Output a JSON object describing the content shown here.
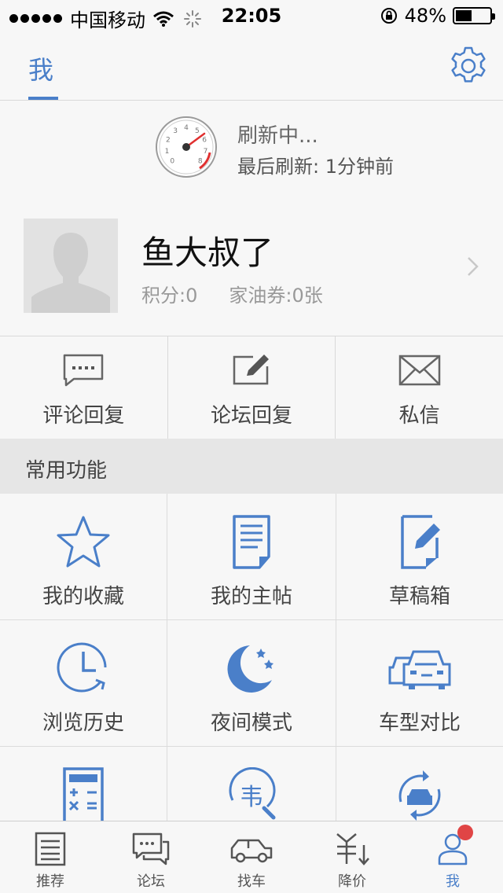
{
  "status_bar": {
    "carrier": "中国移动",
    "time": "22:05",
    "battery_percent": "48%",
    "battery_level": 0.48
  },
  "nav": {
    "tab_label": "我",
    "accent_color": "#4a7fc9",
    "settings_icon": "gear-icon"
  },
  "refresh": {
    "title": "刷新中...",
    "last_refresh": "最后刷新: 1分钟前",
    "gauge_numbers": [
      "0",
      "1",
      "2",
      "3",
      "4",
      "5",
      "6",
      "7",
      "8"
    ]
  },
  "profile": {
    "username": "鱼大叔了",
    "points": "积分:0",
    "coupons": "家油券:0张"
  },
  "quick_actions": [
    {
      "label": "评论回复",
      "icon": "comment-icon"
    },
    {
      "label": "论坛回复",
      "icon": "edit-icon"
    },
    {
      "label": "私信",
      "icon": "mail-icon"
    }
  ],
  "section_title": "常用功能",
  "features": [
    {
      "label": "我的收藏",
      "icon": "star-icon"
    },
    {
      "label": "我的主帖",
      "icon": "document-icon"
    },
    {
      "label": "草稿箱",
      "icon": "draft-icon"
    },
    {
      "label": "浏览历史",
      "icon": "clock-icon"
    },
    {
      "label": "夜间模式",
      "icon": "moon-icon"
    },
    {
      "label": "车型对比",
      "icon": "car-compare-icon"
    },
    {
      "label": "",
      "icon": "calculator-icon"
    },
    {
      "label": "",
      "icon": "violation-search-icon"
    },
    {
      "label": "",
      "icon": "car-replace-icon"
    }
  ],
  "tabbar": [
    {
      "label": "推荐",
      "icon": "list-icon"
    },
    {
      "label": "论坛",
      "icon": "chat-icon"
    },
    {
      "label": "找车",
      "icon": "car-icon"
    },
    {
      "label": "降价",
      "icon": "price-down-icon"
    },
    {
      "label": "我",
      "icon": "user-icon",
      "active": true,
      "badge": true
    }
  ]
}
